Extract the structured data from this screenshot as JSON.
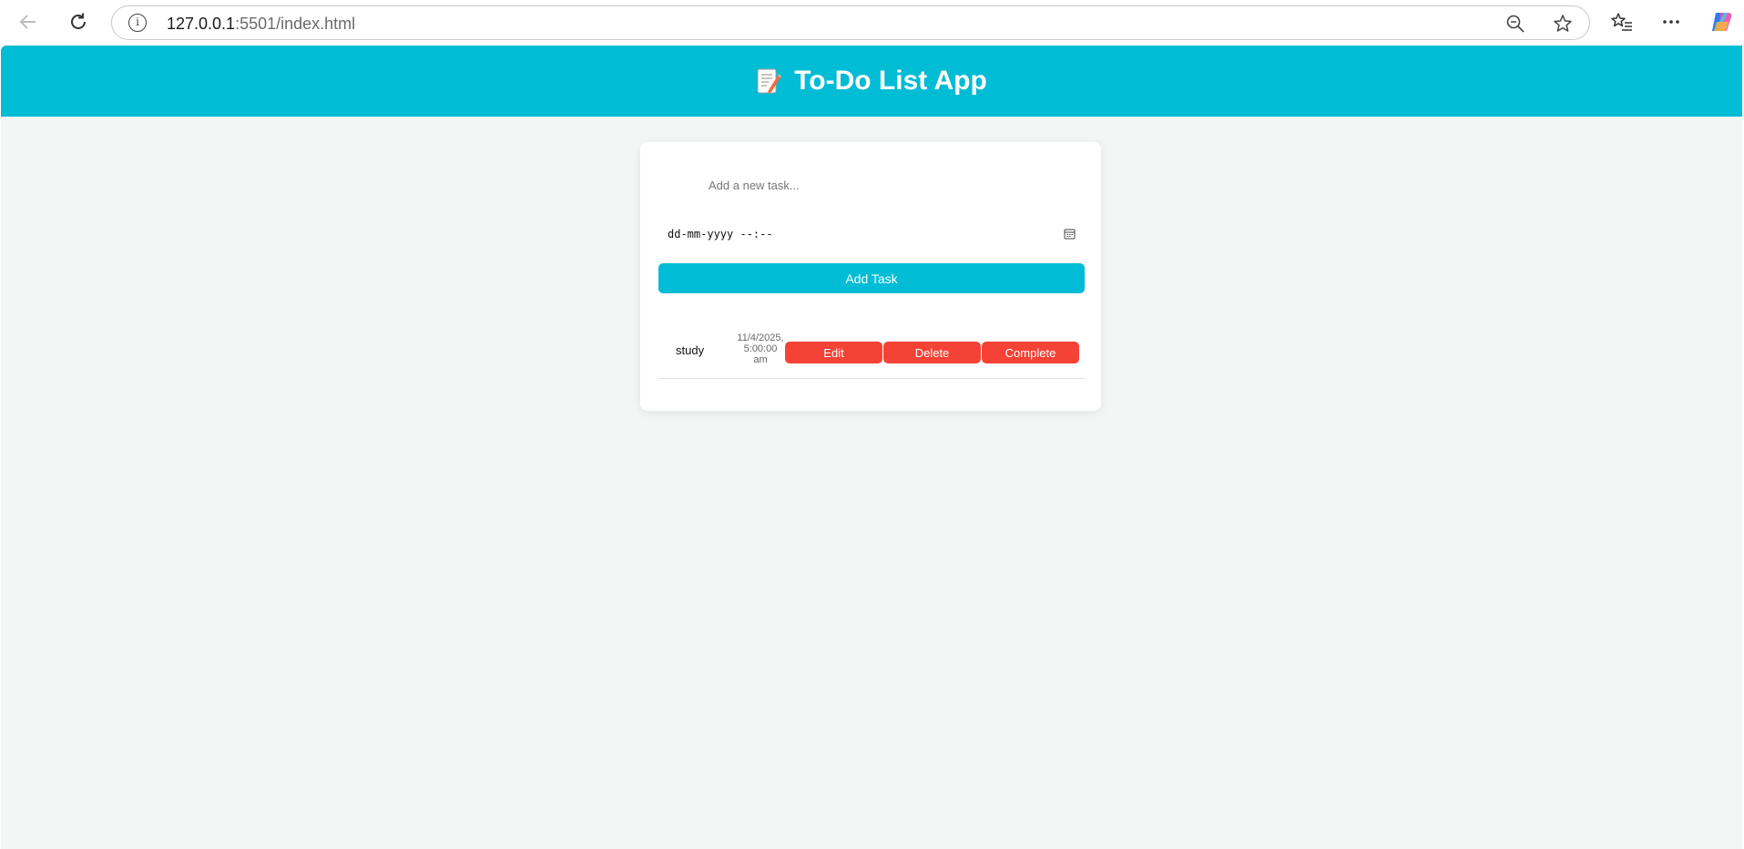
{
  "browser": {
    "url_host": "127.0.0.1",
    "url_path": ":5501/index.html",
    "info_icon": "i"
  },
  "app": {
    "title": "To-Do List App",
    "title_icon": "memo-icon",
    "header_color": "#00bcd4"
  },
  "form": {
    "task_placeholder": "Add a new task...",
    "date_placeholder": "dd-mm-yyyy --:--",
    "add_button_label": "Add Task"
  },
  "tasks": [
    {
      "name": "study",
      "date_line1": "11/4/2025,",
      "date_line2": "5:00:00",
      "date_line3": "am",
      "edit_label": "Edit",
      "delete_label": "Delete",
      "complete_label": "Complete"
    }
  ],
  "colors": {
    "accent": "#00bcd4",
    "danger": "#f44336",
    "background": "#f4f6f5"
  }
}
